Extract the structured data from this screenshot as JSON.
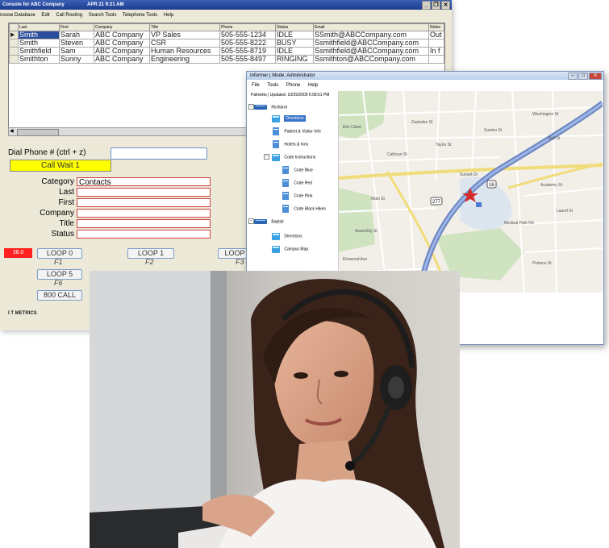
{
  "console": {
    "title": "Console for ABC Company",
    "date": "APR 21   9:21 AM",
    "menu": [
      "noose Database",
      "Edit",
      "Call Routing",
      "Search Tools",
      "Telephone Tools",
      "Help"
    ],
    "columns": [
      "Last",
      "First",
      "Company",
      "Title",
      "Phone",
      "Status",
      "Email",
      "Notes"
    ],
    "rows": [
      {
        "last": "Smith",
        "first": "Sarah",
        "company": "ABC Company",
        "title": "VP Sales",
        "phone": "505-555-1234",
        "status": "IDLE",
        "email": "SSmith@ABCCompany.com",
        "notes": "Out"
      },
      {
        "last": "Smith",
        "first": "Steven",
        "company": "ABC Company",
        "title": "CSR",
        "phone": "505-555-8222",
        "status": "BUSY",
        "email": "Ssmithfield@ABCCompany.com",
        "notes": ""
      },
      {
        "last": "Smithfield",
        "first": "Sam",
        "company": "ABC Company",
        "title": "Human Resources",
        "phone": "505-555-8719",
        "status": "IDLE",
        "email": "Ssmithfield@ABCCompany.com",
        "notes": "In f"
      },
      {
        "last": "Smithton",
        "first": "Sunny",
        "company": "ABC Company",
        "title": "Engineering",
        "phone": "505-555-8497",
        "status": "RINGING",
        "email": "Ssmithton@ABCCompany.com",
        "notes": ""
      }
    ],
    "dial_label": "Dial Phone # (ctrl + z)",
    "call_wait": "Call Wait 1",
    "form": {
      "category_label": "Category",
      "category_value": "Contacts",
      "last_label": "Last",
      "first_label": "First",
      "company_label": "Company",
      "title_label": "Title",
      "status_label": "Status"
    },
    "red_indicator": "38.0",
    "loops": [
      {
        "label": "LOOP 0",
        "key": "F1"
      },
      {
        "label": "LOOP 1",
        "key": "F2"
      },
      {
        "label": "LOOP",
        "key": "F3"
      },
      {
        "label": "LOOP 5",
        "key": "F6"
      }
    ],
    "call_800": "800 CALL",
    "metrics": "I T METRICS"
  },
  "informer": {
    "title": "Informer | Mode: Administrator",
    "menu": [
      "File",
      "Tools",
      "Phone",
      "Help"
    ],
    "updated": "Palmetto | Updated: 10/29/2009 6:08:51 PM",
    "tree": [
      {
        "label": "Richland",
        "level": 0
      },
      {
        "label": "Directions",
        "level": 1,
        "selected": true
      },
      {
        "label": "Patient & Visitor Info",
        "level": 1
      },
      {
        "label": "Hotels & Inns",
        "level": 1
      },
      {
        "label": "Code Instructions",
        "level": 1
      },
      {
        "label": "Code Blue",
        "level": 2
      },
      {
        "label": "Code Red",
        "level": 2
      },
      {
        "label": "Code Pink",
        "level": 2
      },
      {
        "label": "Code Black Hikes",
        "level": 2
      },
      {
        "label": "Baptist",
        "level": 0
      },
      {
        "label": "Directions",
        "level": 1
      },
      {
        "label": "Campus Map",
        "level": 1
      }
    ],
    "map_labels": [
      "Elm Claire",
      "Sunset Dr",
      "Academy St",
      "Medical Park Rd",
      "Gadsden St",
      "Washington St",
      "Taylor St",
      "Bull St",
      "Sumter St",
      "Main St",
      "Assembly St",
      "Pickens St",
      "Laurel St",
      "Calhoun St",
      "Elmwood Ave",
      "277",
      "16"
    ]
  },
  "photo": {
    "subject": "woman-with-headset-at-computer"
  }
}
